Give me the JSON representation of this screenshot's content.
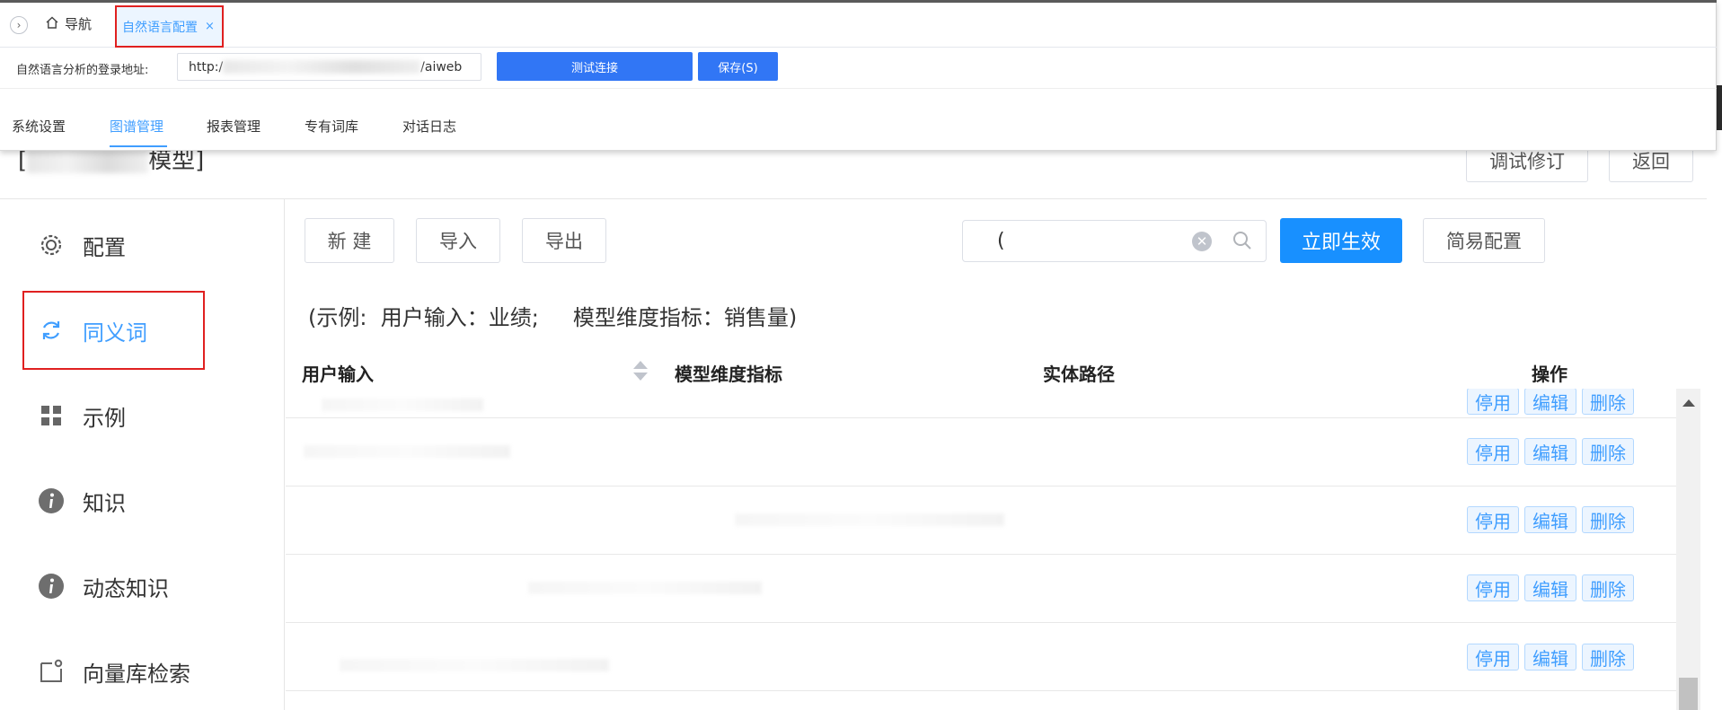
{
  "window": {
    "nav_toggle_glyph": "›",
    "home_tab": "导航",
    "active_tab": "自然语言配置",
    "tab_close": "×"
  },
  "connection": {
    "label": "自然语言分析的登录地址:",
    "url_prefix": "http:/",
    "url_suffix": "/aiweb",
    "test_button": "测试连接",
    "save_button": "保存(S)"
  },
  "menu": {
    "items": [
      "系统设置",
      "图谱管理",
      "报表管理",
      "专有词库",
      "对话日志"
    ],
    "active": "图谱管理"
  },
  "page": {
    "title_prefix": "[",
    "title_suffix": "模型]",
    "debug_button": "调试修订",
    "back_button": "返回"
  },
  "sidebar": {
    "items": [
      {
        "label": "配置",
        "icon": "gear-icon"
      },
      {
        "label": "同义词",
        "icon": "refresh-icon",
        "active": true
      },
      {
        "label": "示例",
        "icon": "grid-icon"
      },
      {
        "label": "知识",
        "icon": "info-icon"
      },
      {
        "label": "动态知识",
        "icon": "info-icon"
      },
      {
        "label": "向量库检索",
        "icon": "vector-search-icon"
      }
    ]
  },
  "toolbar": {
    "new_label": "新 建",
    "import_label": "导入",
    "export_label": "导出",
    "search_value": "(",
    "apply_label": "立即生效",
    "simple_config_label": "简易配置"
  },
  "hint": "(示例:  用户输入：业绩;     模型维度指标：销售量)",
  "table": {
    "columns": [
      "用户输入",
      "模型维度指标",
      "实体路径",
      "操作"
    ],
    "row_actions": [
      "停用",
      "编辑",
      "删除"
    ],
    "row_count": 5
  },
  "colors": {
    "accent": "#409eff",
    "primary_button": "#1890ff",
    "header_button": "#3176f5",
    "highlight_box": "#e02020"
  }
}
